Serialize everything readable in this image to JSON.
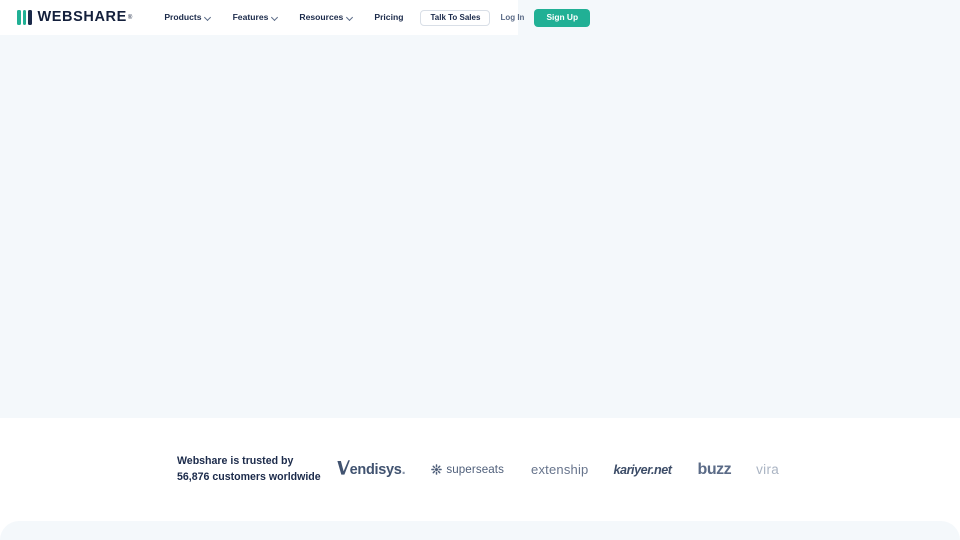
{
  "brand": {
    "name": "WEBSHARE",
    "trademark": "®",
    "accent_color": "#21b095",
    "dark_color": "#14203c"
  },
  "header": {
    "nav": [
      {
        "label": "Products",
        "has_chevron": true,
        "icon": "chevron-down-icon"
      },
      {
        "label": "Features",
        "has_chevron": true,
        "icon": "chevron-down-icon"
      },
      {
        "label": "Resources",
        "has_chevron": true,
        "icon": "chevron-down-icon"
      },
      {
        "label": "Pricing",
        "has_chevron": false,
        "icon": ""
      }
    ],
    "actions": {
      "talk_to_sales": "Talk To Sales",
      "log_in": "Log In",
      "sign_up": "Sign Up"
    }
  },
  "trusted": {
    "line1": "Webshare is trusted by",
    "line2": "56,876 customers worldwide",
    "customer_count": "56,876",
    "logos": [
      {
        "name": "Vendisys",
        "label": "endisys",
        "mark": "V",
        "suffix": "."
      },
      {
        "name": "superseats",
        "label": "superseats",
        "icon": "starburst-icon"
      },
      {
        "name": "extenship",
        "label": "extenship"
      },
      {
        "name": "kariyer.net",
        "label": "kariyer.net"
      },
      {
        "name": "buzz",
        "label": "buzz"
      },
      {
        "name": "vira",
        "label": "vira"
      }
    ]
  },
  "theme": {
    "hero_background": "#f4f8fb",
    "page_background": "#ffffff",
    "text_dark": "#1b2a4a",
    "text_muted": "#5b6b87"
  }
}
